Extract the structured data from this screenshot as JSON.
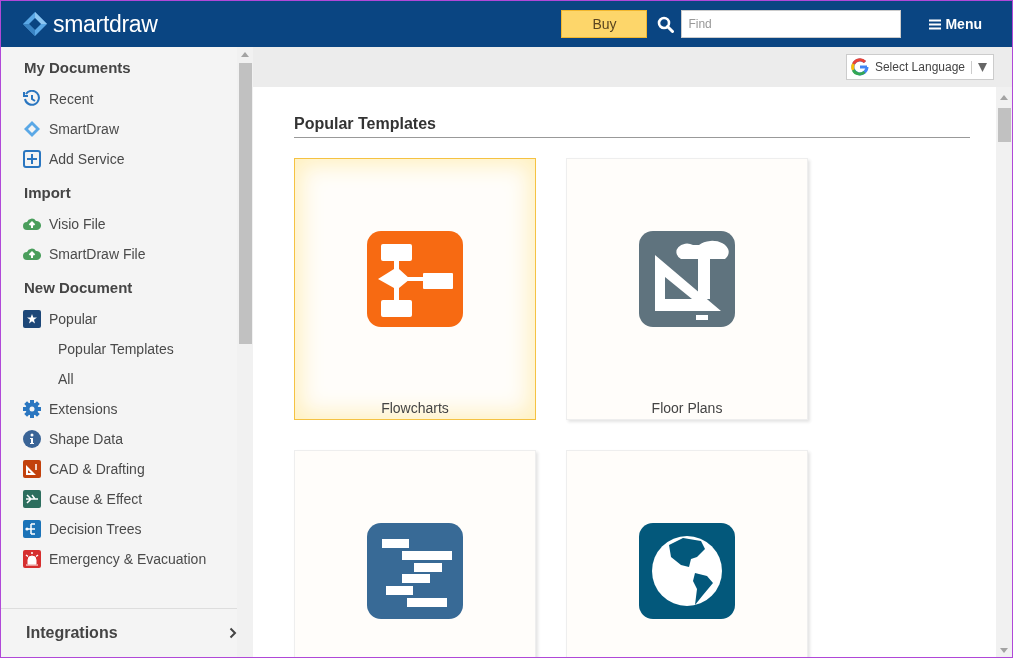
{
  "header": {
    "logo": "smartdraw",
    "buy_button": "Buy",
    "search": {
      "placeholder": "Find"
    },
    "menu": "Menu"
  },
  "sidebar": {
    "sections": [
      {
        "title": "My Documents",
        "items": [
          {
            "label": "Recent",
            "kind": "recent"
          },
          {
            "label": "SmartDraw",
            "kind": "smartdraw"
          },
          {
            "label": "Add Service",
            "kind": "add"
          }
        ]
      },
      {
        "title": "Import",
        "items": [
          {
            "label": "Visio File",
            "kind": "upload"
          },
          {
            "label": "SmartDraw File",
            "kind": "upload"
          }
        ]
      },
      {
        "title": "New Document",
        "items": [
          {
            "label": "Popular",
            "kind": "star",
            "children": [
              {
                "label": "Popular Templates"
              },
              {
                "label": "All"
              }
            ]
          },
          {
            "label": "Extensions",
            "kind": "gear"
          },
          {
            "label": "Shape Data",
            "kind": "info"
          },
          {
            "label": "CAD & Drafting",
            "kind": "cad"
          },
          {
            "label": "Cause & Effect",
            "kind": "cause"
          },
          {
            "label": "Decision Trees",
            "kind": "tree"
          },
          {
            "label": "Emergency & Evacuation",
            "kind": "alarm"
          }
        ]
      }
    ],
    "footer": {
      "label": "Integrations"
    }
  },
  "language_select": {
    "label": "Select Language"
  },
  "content": {
    "title": "Popular Templates",
    "cards": [
      {
        "label": "Flowcharts",
        "kind": "flowchart",
        "selected": true
      },
      {
        "label": "Floor Plans",
        "kind": "floorplan",
        "selected": false
      },
      {
        "kind": "gantt",
        "selected": false
      },
      {
        "kind": "globe",
        "selected": false
      }
    ]
  }
}
